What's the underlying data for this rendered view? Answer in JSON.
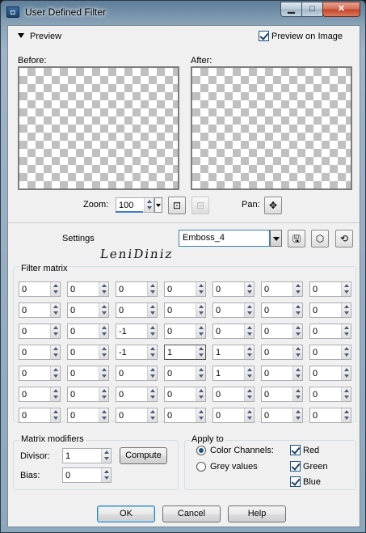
{
  "window": {
    "title": "User Defined Filter"
  },
  "preview": {
    "toggle_label": "Preview",
    "preview_on_image_label": "Preview on Image",
    "preview_on_image_checked": true,
    "before_label": "Before:",
    "after_label": "After:",
    "zoom_label": "Zoom:",
    "zoom_value": "100",
    "pan_label": "Pan:"
  },
  "settings": {
    "label": "Settings",
    "selected": "Emboss_4"
  },
  "signature_text": "LeniDiniz",
  "matrix": {
    "title": "Filter matrix",
    "rows": [
      [
        "0",
        "0",
        "0",
        "0",
        "0",
        "0",
        "0"
      ],
      [
        "0",
        "0",
        "0",
        "0",
        "0",
        "0",
        "0"
      ],
      [
        "0",
        "0",
        "-1",
        "0",
        "0",
        "0",
        "0"
      ],
      [
        "0",
        "0",
        "-1",
        "1",
        "1",
        "0",
        "0"
      ],
      [
        "0",
        "0",
        "0",
        "0",
        "1",
        "0",
        "0"
      ],
      [
        "0",
        "0",
        "0",
        "0",
        "0",
        "0",
        "0"
      ],
      [
        "0",
        "0",
        "0",
        "0",
        "0",
        "0",
        "0"
      ]
    ]
  },
  "modifiers": {
    "title": "Matrix modifiers",
    "divisor_label": "Divisor:",
    "divisor_value": "1",
    "compute_label": "Compute",
    "bias_label": "Bias:",
    "bias_value": "0"
  },
  "apply_to": {
    "title": "Apply to",
    "color_channels_label": "Color Channels:",
    "grey_values_label": "Grey values",
    "selected": "color_channels",
    "red_label": "Red",
    "red_checked": true,
    "green_label": "Green",
    "green_checked": true,
    "blue_label": "Blue",
    "blue_checked": true
  },
  "buttons": {
    "ok": "OK",
    "cancel": "Cancel",
    "help": "Help"
  }
}
